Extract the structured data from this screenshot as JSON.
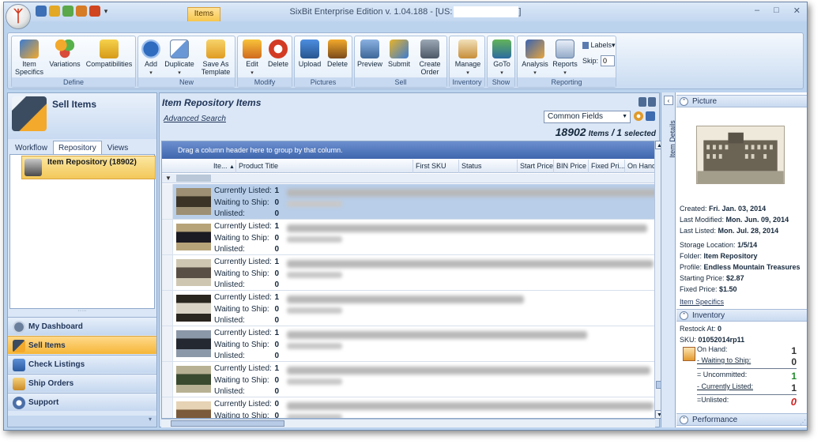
{
  "window": {
    "title": "SixBit Enterprise Edition v. 1.04.188 - [US:",
    "title_suffix": "]",
    "controls": [
      "–",
      "□",
      "✕"
    ]
  },
  "ribbon": {
    "context_tab": "Items",
    "groups": [
      {
        "label": "Define",
        "buttons": [
          "Item Specifics",
          "Variations",
          "Compatibilities"
        ]
      },
      {
        "label": "New",
        "buttons": [
          "Add",
          "Duplicate",
          "Save As Template"
        ]
      },
      {
        "label": "Modify",
        "buttons": [
          "Edit",
          "Delete"
        ]
      },
      {
        "label": "Pictures",
        "buttons": [
          "Upload",
          "Delete"
        ]
      },
      {
        "label": "Sell",
        "buttons": [
          "Preview",
          "Submit",
          "Create Order"
        ]
      },
      {
        "label": "Inventory",
        "buttons": [
          "Manage"
        ]
      },
      {
        "label": "Show",
        "buttons": [
          "GoTo"
        ]
      },
      {
        "label": "Reporting",
        "buttons": [
          "Analysis",
          "Reports"
        ]
      }
    ],
    "labels_button": "Labels",
    "skip_label": "Skip:",
    "skip_value": "0"
  },
  "left": {
    "title": "Sell Items",
    "tabs": [
      "Workflow",
      "Repository",
      "Views"
    ],
    "active_tab": "Repository",
    "tree_item": "Item Repository (18902)",
    "splitter": "·····",
    "nav": [
      "My Dashboard",
      "Sell Items",
      "Check Listings",
      "Ship Orders",
      "Support"
    ],
    "active_nav": "Sell Items",
    "footer_caret": "▾"
  },
  "center": {
    "title": "Item Repository Items",
    "advanced_search": "Advanced Search",
    "field_select": "Common Fields",
    "count_total": "18902",
    "count_items_label": "Items",
    "count_sep": "/",
    "count_selected": "1",
    "count_selected_label": "selected",
    "group_hint": "Drag a column header here to group by that column.",
    "columns": [
      "Ite...",
      "Product Title",
      "First SKU",
      "Status",
      "Start Price",
      "BIN Price",
      "Fixed Pri...",
      "On Hand"
    ],
    "count_labels": [
      "Currently Listed:",
      "Waiting to Ship:",
      "Unlisted:"
    ],
    "rows": [
      {
        "listed": "1",
        "waiting": "0",
        "unlisted": "0",
        "selected": true
      },
      {
        "listed": "1",
        "waiting": "0",
        "unlisted": "0",
        "selected": false
      },
      {
        "listed": "1",
        "waiting": "0",
        "unlisted": "0",
        "selected": false
      },
      {
        "listed": "1",
        "waiting": "0",
        "unlisted": "0",
        "selected": false
      },
      {
        "listed": "1",
        "waiting": "0",
        "unlisted": "0",
        "selected": false
      },
      {
        "listed": "1",
        "waiting": "0",
        "unlisted": "0",
        "selected": false
      },
      {
        "listed": "0",
        "waiting": "0",
        "unlisted": "",
        "selected": false
      }
    ]
  },
  "right": {
    "strip_label": "Item Details",
    "picture_header": "Picture",
    "created_label": "Created:",
    "created": "Fri. Jan. 03, 2014",
    "modified_label": "Last Modified:",
    "modified": "Mon. Jun. 09, 2014",
    "listed_label": "Last Listed:",
    "listed": "Mon. Jul. 28, 2014",
    "storage_label": "Storage Location:",
    "storage": "1/5/14",
    "folder_label": "Folder:",
    "folder": "Item Repository",
    "profile_label": "Profile:",
    "profile": "Endless Mountain Treasures",
    "starting_label": "Starting Price:",
    "starting": "$2.87",
    "fixed_label": "Fixed Price:",
    "fixed": "$1.50",
    "item_specifics_link": "Item Specifics",
    "inventory_header": "Inventory",
    "restock_label": "Restock At:",
    "restock": "0",
    "sku_label": "SKU:",
    "sku": "01052014rp11",
    "on_hand_label": "On Hand:",
    "on_hand": "1",
    "waiting_label": "- Waiting to Ship:",
    "waiting": "0",
    "uncommitted_label": "= Uncommitted:",
    "uncommitted": "1",
    "currently_label": "- Currently Listed:",
    "currently": "1",
    "unlisted_label": "=Unlisted:",
    "unlisted": "0",
    "performance_header": "Performance"
  },
  "colors": {
    "accent_orange": "#f5b637",
    "nav_blue": "#c4d7ef",
    "group_bar": "#3f66ad",
    "uncommitted_green": "#1f8a2a",
    "unlisted_red": "#d21f1f"
  }
}
